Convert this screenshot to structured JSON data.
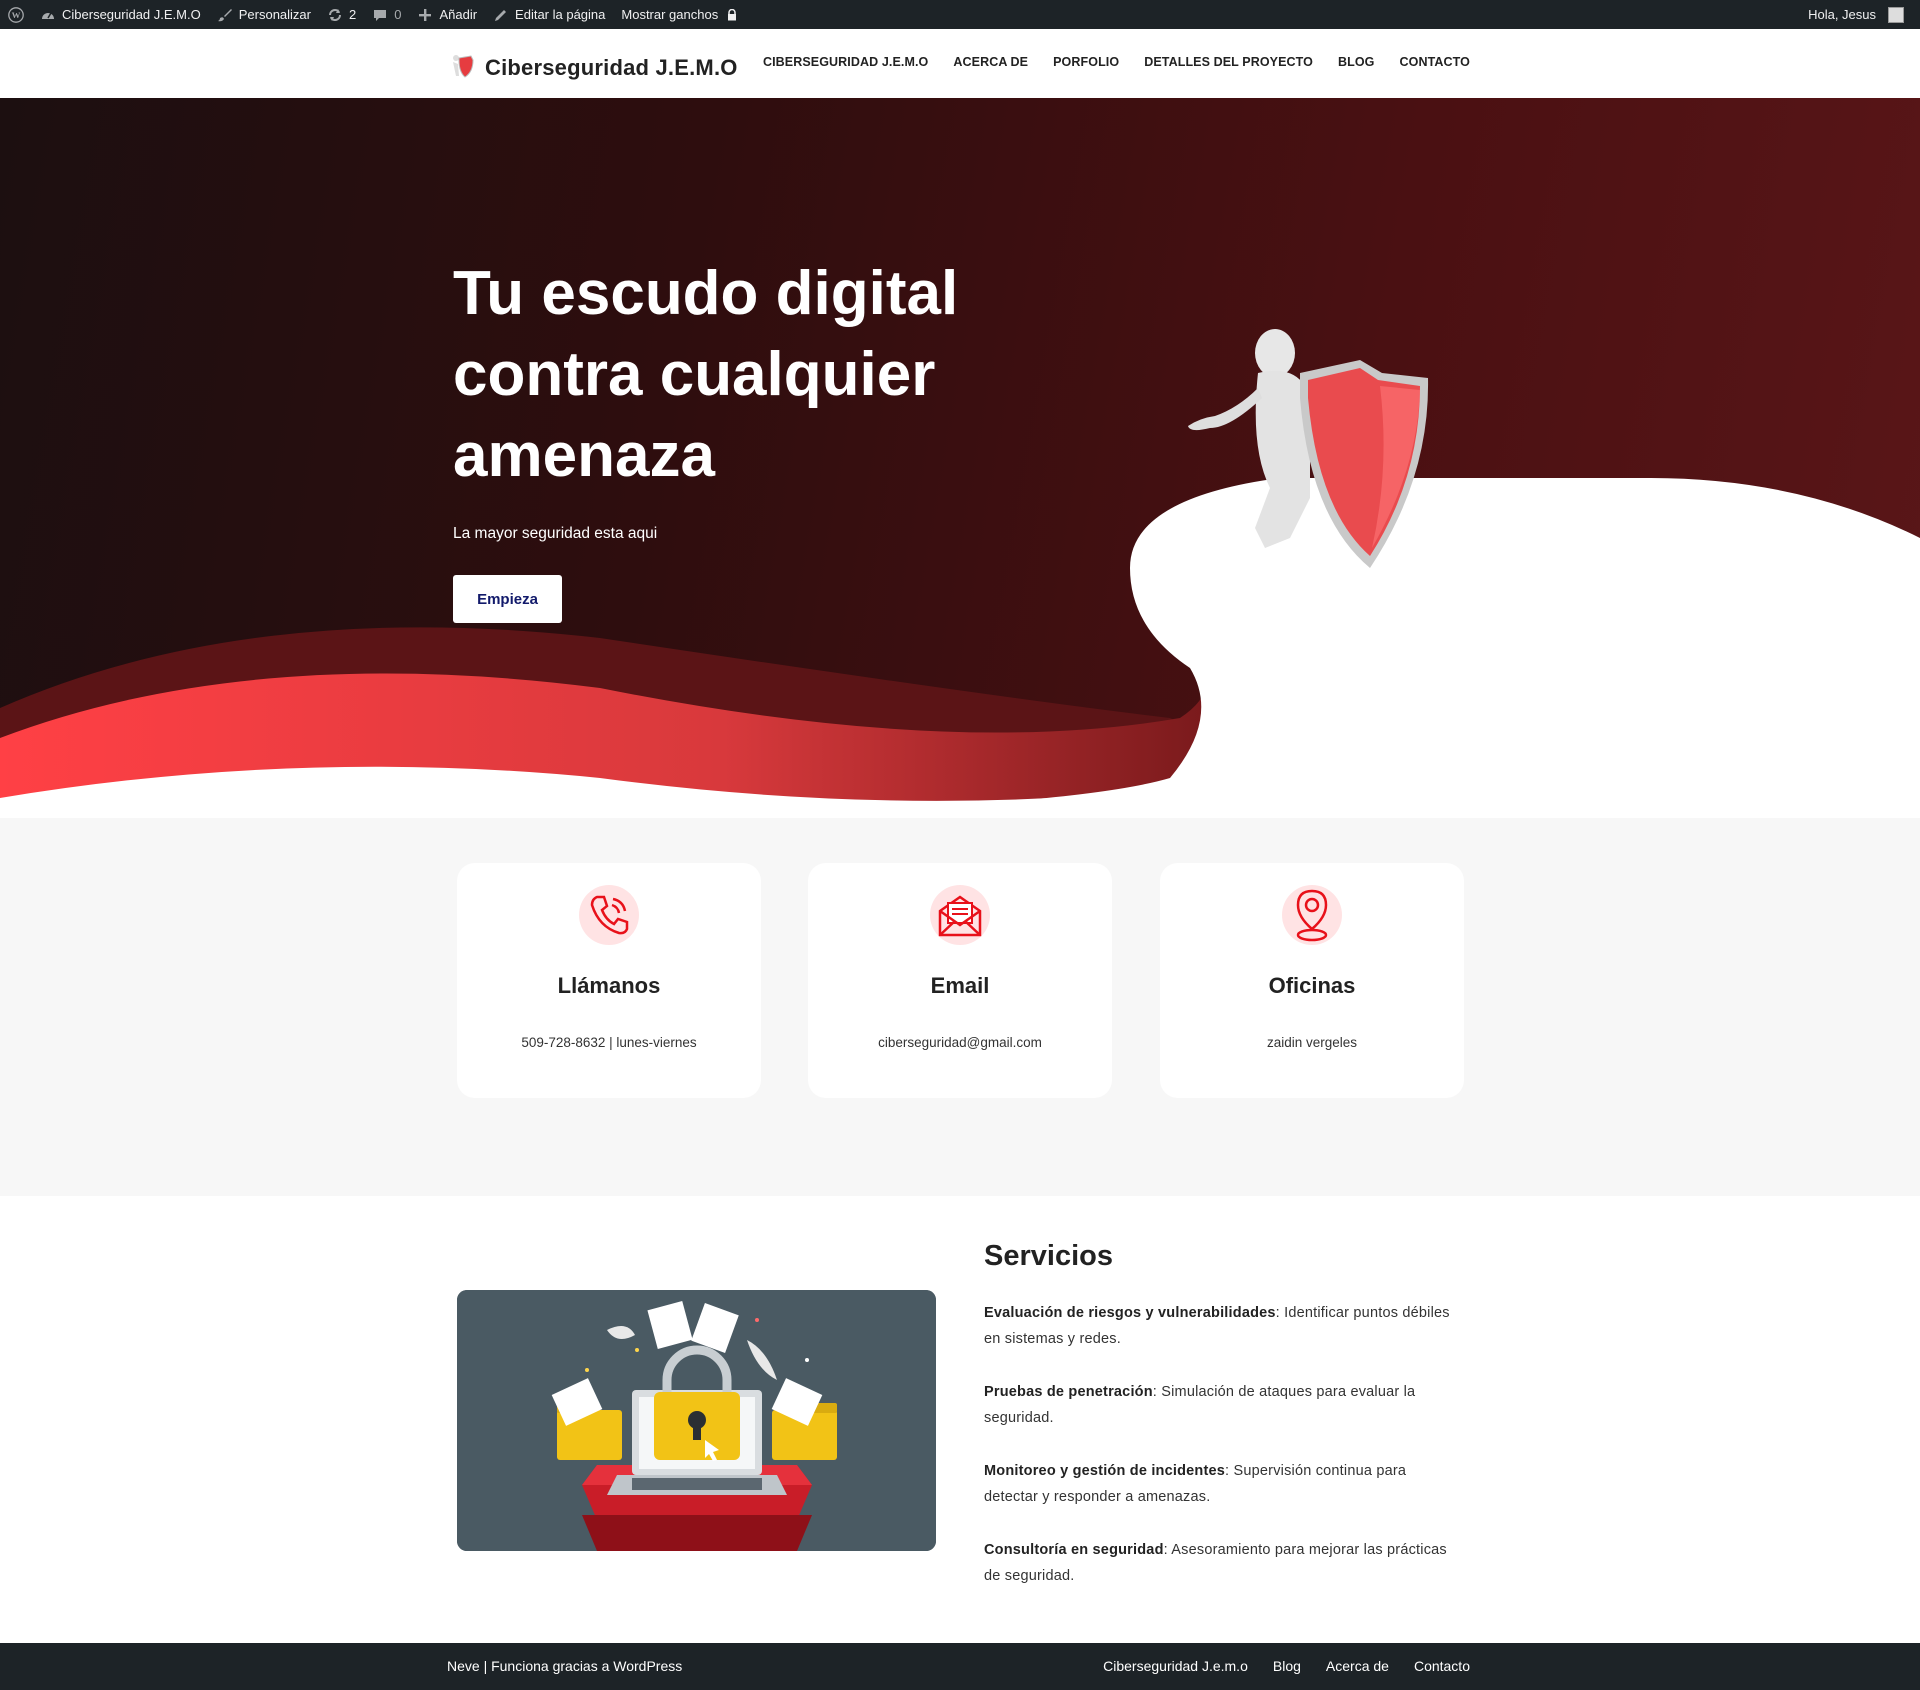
{
  "adminbar": {
    "site_name": "Ciberseguridad J.E.M.O",
    "customize": "Personalizar",
    "updates_count": "2",
    "comments_count": "0",
    "add_new": "Añadir",
    "edit_page": "Editar la página",
    "show_hooks": "Mostrar ganchos",
    "greeting": "Hola, Jesus"
  },
  "header": {
    "brand_title": "Ciberseguridad J.E.M.O",
    "nav": [
      "CIBERSEGURIDAD J.E.M.O",
      "ACERCA DE",
      "PORFOLIO",
      "DETALLES DEL PROYECTO",
      "BLOG",
      "CONTACTO"
    ]
  },
  "hero": {
    "title": "Tu escudo digital contra cualquier amenaza",
    "subtitle": "La mayor seguridad esta aqui",
    "button": "Empieza"
  },
  "contact": {
    "cards": [
      {
        "title": "Llámanos",
        "text": "509-728-8632 | lunes-viernes",
        "icon": "phone-icon"
      },
      {
        "title": "Email",
        "text": "ciberseguridad@gmail.com",
        "icon": "envelope-icon"
      },
      {
        "title": "Oficinas",
        "text": "zaidin vergeles",
        "icon": "location-pin-icon"
      }
    ]
  },
  "services": {
    "title": "Servicios",
    "items": [
      {
        "term": "Evaluación de riesgos y vulnerabilidades",
        "desc": ": Identificar puntos débiles en sistemas y redes."
      },
      {
        "term": "Pruebas de penetración",
        "desc": ": Simulación de ataques para evaluar la seguridad."
      },
      {
        "term": "Monitoreo y gestión de incidentes",
        "desc": ": Supervisión continua para detectar y responder a amenazas."
      },
      {
        "term": "Consultoría en seguridad",
        "desc": ": Asesoramiento para mejorar las prácticas de seguridad."
      }
    ]
  },
  "footer": {
    "credit": "Neve | Funciona gracias a WordPress",
    "nav": [
      "Ciberseguridad J.e.m.o",
      "Blog",
      "Acerca de",
      "Contacto"
    ]
  },
  "colors": {
    "accent_red": "#ff4045",
    "admin_bar": "#1d2327",
    "button_text": "#121a6b"
  }
}
